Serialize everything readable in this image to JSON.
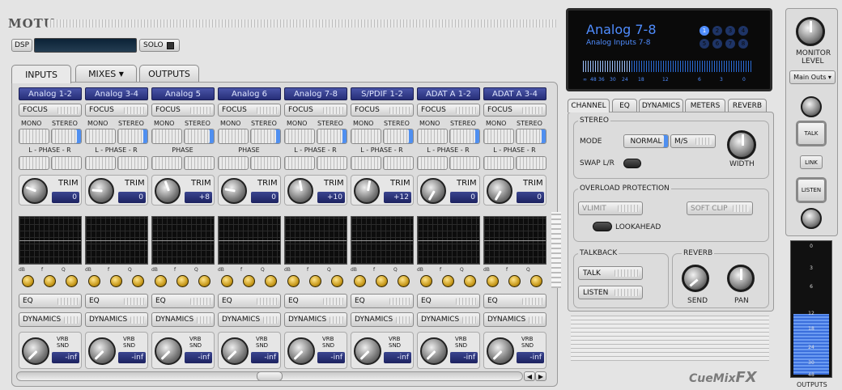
{
  "brand": "MOTU",
  "dsp": {
    "label": "DSP",
    "solo_label": "SOLO"
  },
  "tabs": [
    {
      "label": "INPUTS",
      "active": true
    },
    {
      "label": "MIXES",
      "dropdown": true
    },
    {
      "label": "OUTPUTS"
    }
  ],
  "tabs_dropdown_icon": "▼",
  "channels": [
    {
      "name": "Analog 1-2",
      "focus": "FOCUS",
      "mono": "MONO",
      "stereo": "STEREO",
      "phase": "L - PHASE - R",
      "trim_label": "TRIM",
      "trim": "0",
      "eq": "EQ",
      "dynamics": "DYNAMICS",
      "vrb_label": "VRB SND",
      "vrb": "-inf"
    },
    {
      "name": "Analog 3-4",
      "focus": "FOCUS",
      "mono": "MONO",
      "stereo": "STEREO",
      "phase": "L - PHASE - R",
      "trim_label": "TRIM",
      "trim": "0",
      "eq": "EQ",
      "dynamics": "DYNAMICS",
      "vrb_label": "VRB SND",
      "vrb": "-inf"
    },
    {
      "name": "Analog 5",
      "focus": "FOCUS",
      "mono": "MONO",
      "stereo": "STEREO",
      "phase": "PHASE",
      "trim_label": "TRIM",
      "trim": "+8",
      "eq": "EQ",
      "dynamics": "DYNAMICS",
      "vrb_label": "VRB SND",
      "vrb": "-inf"
    },
    {
      "name": "Analog 6",
      "focus": "FOCUS",
      "mono": "MONO",
      "stereo": "STEREO",
      "phase": "PHASE",
      "trim_label": "TRIM",
      "trim": "0",
      "eq": "EQ",
      "dynamics": "DYNAMICS",
      "vrb_label": "VRB SND",
      "vrb": "-inf"
    },
    {
      "name": "Analog 7-8",
      "focus": "FOCUS",
      "mono": "MONO",
      "stereo": "STEREO",
      "phase": "L - PHASE - R",
      "trim_label": "TRIM",
      "trim": "+10",
      "eq": "EQ",
      "dynamics": "DYNAMICS",
      "vrb_label": "VRB SND",
      "vrb": "-inf"
    },
    {
      "name": "S/PDIF 1-2",
      "focus": "FOCUS",
      "mono": "MONO",
      "stereo": "STEREO",
      "phase": "L - PHASE - R",
      "trim_label": "TRIM",
      "trim": "+12",
      "eq": "EQ",
      "dynamics": "DYNAMICS",
      "vrb_label": "VRB SND",
      "vrb": "-inf"
    },
    {
      "name": "ADAT A 1-2",
      "focus": "FOCUS",
      "mono": "MONO",
      "stereo": "STEREO",
      "phase": "L - PHASE - R",
      "trim_label": "TRIM",
      "trim": "0",
      "eq": "EQ",
      "dynamics": "DYNAMICS",
      "vrb_label": "VRB SND",
      "vrb": "-inf"
    },
    {
      "name": "ADAT A 3-4",
      "focus": "FOCUS",
      "mono": "MONO",
      "stereo": "STEREO",
      "phase": "L - PHASE - R",
      "trim_label": "TRIM",
      "trim": "0",
      "eq": "EQ",
      "dynamics": "DYNAMICS",
      "vrb_label": "VRB SND",
      "vrb": "-inf"
    }
  ],
  "eq_knob_labels": {
    "db": "dB",
    "f": "f",
    "q": "Q"
  },
  "display": {
    "title": "Analog 7-8",
    "subtitle": "Analog Inputs 7-8",
    "dots": [
      "1",
      "2",
      "3",
      "4",
      "5",
      "6",
      "7",
      "8"
    ],
    "scale": [
      "∞",
      "48",
      "36",
      "30",
      "24",
      "18",
      "12",
      "6",
      "3",
      "0"
    ]
  },
  "right_tabs": [
    "CHANNEL",
    "EQ",
    "DYNAMICS",
    "METERS",
    "REVERB"
  ],
  "stereo": {
    "title": "STEREO",
    "mode_label": "MODE",
    "normal": "NORMAL",
    "ms": "M/S",
    "swap": "SWAP L/R",
    "width": "WIDTH"
  },
  "overload": {
    "title": "OVERLOAD PROTECTION",
    "vlimit": "VLIMIT",
    "softclip": "SOFT CLIP",
    "lookahead": "LOOKAHEAD"
  },
  "talkback": {
    "title": "TALKBACK",
    "talk": "TALK",
    "listen": "LISTEN"
  },
  "reverb": {
    "title": "REVERB",
    "send": "SEND",
    "pan": "PAN"
  },
  "logo": {
    "prefix": "CueMix",
    "suffix": "FX"
  },
  "monitor": {
    "label1": "MONITOR",
    "label2": "LEVEL",
    "select": "Main Outs",
    "talk": "TALK",
    "link": "LINK",
    "listen": "LISTEN"
  },
  "outputs_meter": {
    "label": "OUTPUTS",
    "ticks": [
      "0",
      "3",
      "6",
      "12",
      "18",
      "24",
      "30",
      "48"
    ]
  }
}
